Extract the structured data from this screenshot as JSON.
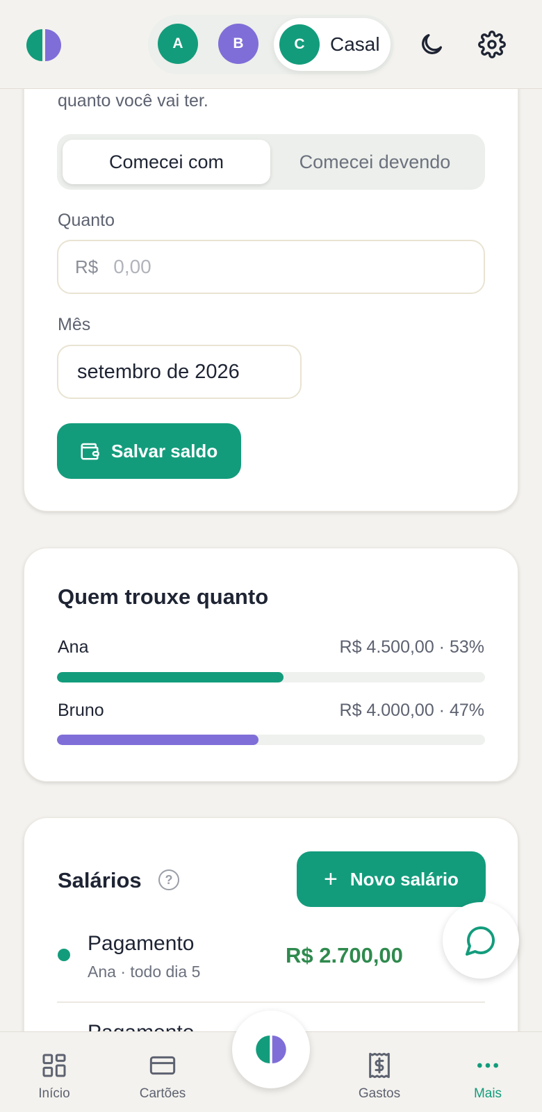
{
  "header": {
    "profiles": [
      {
        "initial": "A",
        "color": "#139c7c"
      },
      {
        "initial": "B",
        "color": "#7f6ed8"
      },
      {
        "initial": "C",
        "label": "Casal",
        "color": "#139c7c",
        "selected": true
      }
    ],
    "icons": [
      "app-logo",
      "moon-icon",
      "gear-icon"
    ]
  },
  "balance_form": {
    "faded_text": "quanto você vai ter.",
    "segment": {
      "options": [
        "Comecei com",
        "Comecei devendo"
      ],
      "selected": "Comecei com"
    },
    "amount_label": "Quanto",
    "currency": "R$",
    "amount_placeholder": "0,00",
    "month_label": "Mês",
    "month_value": "setembro de 2026",
    "save_label": "Salvar saldo"
  },
  "contributions": {
    "title": "Quem trouxe quanto",
    "people": [
      {
        "name": "Ana",
        "value": "R$ 4.500,00 · 53%",
        "share": 0.53,
        "color": "#139c7c"
      },
      {
        "name": "Bruno",
        "value": "R$ 4.000,00 · 47%",
        "share": 0.47,
        "color": "#7f6ed8"
      }
    ]
  },
  "salaries": {
    "title": "Salários",
    "help_symbol": "?",
    "new_label": "Novo salário",
    "items": [
      {
        "name": "Pagamento",
        "sub": "Ana · todo dia 5",
        "value": "R$ 2.700,00"
      },
      {
        "name": "Pagamento"
      }
    ]
  },
  "bottom_nav": {
    "items": [
      {
        "label": "Início",
        "icon": "grid-icon"
      },
      {
        "label": "Cartões",
        "icon": "card-icon"
      },
      {
        "label": "Gastos",
        "icon": "receipt-icon"
      },
      {
        "label": "Mais",
        "icon": "more-icon",
        "active": true
      }
    ]
  },
  "colors": {
    "accent": "#139c7c",
    "secondary": "#7f6ed8",
    "positive": "#2f8a4e",
    "background": "#f4f2ee"
  }
}
